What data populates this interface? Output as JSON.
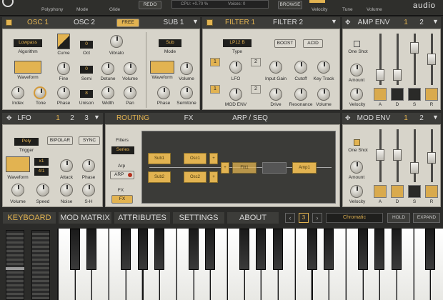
{
  "top": {
    "items": [
      "Polyphony",
      "Mode",
      "Glide"
    ],
    "redo": "REDO",
    "cpu": "CPU: +0.70 %",
    "voices": "Voices: 0",
    "browse": "BROWSE",
    "right": [
      "Velocity",
      "Tune",
      "Volume"
    ],
    "brand": "audio"
  },
  "osc": {
    "tab1": "OSC 1",
    "tab2": "OSC 2",
    "free": "FREE",
    "sub": "SUB 1",
    "algo_val": "Lowpass",
    "algo": "Algorithm",
    "curve": "Curve",
    "oct_val": "0",
    "oct": "Oct",
    "vibrato": "Vibrato",
    "waveform": "Waveform",
    "fine": "Fine",
    "semi_val": "0",
    "semi": "Semi",
    "detune": "Detune",
    "volume": "Volume",
    "index": "Index",
    "tone": "Tone",
    "phase": "Phase",
    "unison_val": "8",
    "unison": "Unison",
    "width": "Width",
    "pan": "Pan",
    "sub_mode_val": "Sub",
    "sub_mode": "Mode",
    "sub_wave": "Waveform",
    "sub_vol": "Volume",
    "sub_phase": "Phase",
    "semitone": "Semitone"
  },
  "filter": {
    "tab1": "FILTER 1",
    "tab2": "FILTER 2",
    "type_val": "LP12 B",
    "type": "Type",
    "boost": "BOOST",
    "acid": "ACID",
    "lfo": "LFO",
    "input_gain": "Input Gain",
    "cutoff": "Cutoff",
    "key_track": "Key Track",
    "mod_env": "MOD ENV",
    "drive": "Drive",
    "resonance": "Resonance",
    "volume": "Volume",
    "n1": "1",
    "n2": "2"
  },
  "amp": {
    "title": "AMP ENV",
    "n1": "1",
    "n2": "2",
    "oneshot": "One Shot",
    "amount": "Amount",
    "velocity": "Velocity",
    "a": "A",
    "d": "D",
    "s": "S",
    "r": "R"
  },
  "lfo": {
    "title": "LFO",
    "n1": "1",
    "n2": "2",
    "n3": "3",
    "trig_val": "Poly",
    "trigger": "Trigger",
    "bipolar": "BIPOLAR",
    "sync": "SYNC",
    "x1": "x1",
    "ratio": "4/1",
    "waveform": "Waveform",
    "attack": "Attack",
    "phase": "Phase",
    "volume": "Volume",
    "speed": "Speed",
    "noise": "Noise",
    "sh": "S-H"
  },
  "routing": {
    "tab1": "ROUTING",
    "tab2": "FX",
    "tab3": "ARP / SEQ",
    "filters": "Filters",
    "series": "Series",
    "arp": "Arp",
    "arp_btn": "ARP",
    "fx": "FX",
    "fx_btn": "FX",
    "osc1": "Osc1",
    "osc2": "Osc2",
    "sub1": "Sub1",
    "sub2": "Sub2",
    "filt1": "Filt1",
    "amp1": "Amp1"
  },
  "modenv": {
    "title": "MOD ENV",
    "n1": "1",
    "n2": "2",
    "oneshot": "One Shot",
    "amount": "Amount",
    "velocity": "Velocity",
    "a": "A",
    "d": "D",
    "s": "S",
    "r": "R"
  },
  "bottom": {
    "tabs": [
      "KEYBOARD",
      "MOD MATRIX",
      "ATTRIBUTES",
      "SETTINGS",
      "ABOUT"
    ],
    "octave": "3",
    "scale": "Chromatic",
    "hold": "HOLD",
    "expand": "EXPAND"
  }
}
